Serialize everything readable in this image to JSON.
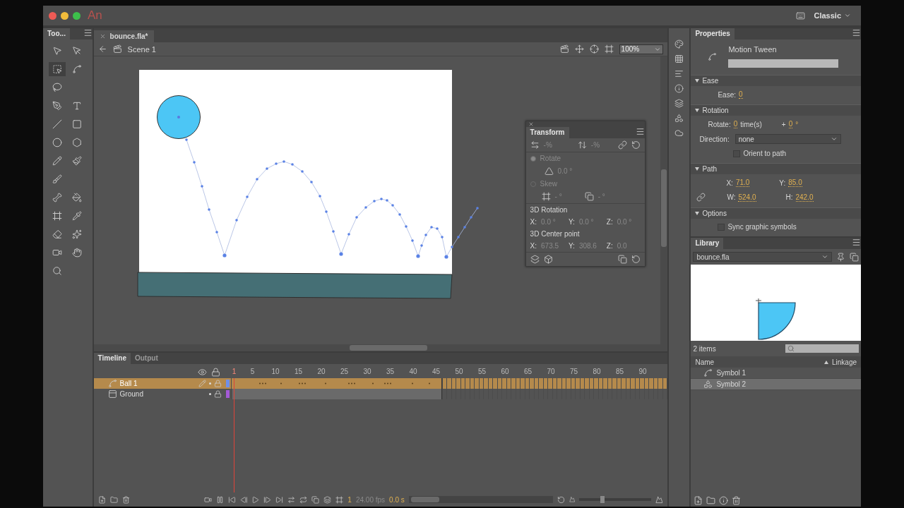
{
  "app": {
    "logo": "An",
    "workspace": "Classic"
  },
  "tools": {
    "title": "Too..."
  },
  "document": {
    "tab": "bounce.fla*",
    "scene": "Scene 1",
    "zoom": "100%"
  },
  "transform": {
    "title": "Transform",
    "disabled": true,
    "width": "-%",
    "height": "-%",
    "modes": [
      {
        "label": "Rotate",
        "selected": true
      },
      {
        "label": "Skew",
        "selected": false
      }
    ],
    "rotate_value": "0.0 °",
    "skew_h": "- °",
    "skew_v": "- °",
    "rotation_3d": {
      "label": "3D Rotation",
      "axes": [
        {
          "axis": "X:",
          "value": "0.0 °"
        },
        {
          "axis": "Y:",
          "value": "0.0 °"
        },
        {
          "axis": "Z:",
          "value": "0.0 °"
        }
      ]
    },
    "center_3d": {
      "label": "3D Center point",
      "axes": [
        {
          "axis": "X:",
          "value": "673.5"
        },
        {
          "axis": "Y:",
          "value": "308.6"
        },
        {
          "axis": "Z:",
          "value": "0.0"
        }
      ]
    }
  },
  "properties": {
    "title": "Properties",
    "type": "Motion Tween",
    "sections": [
      {
        "kind": "ease",
        "title": "Ease",
        "expanded": true,
        "label": "Ease:",
        "value": "0"
      },
      {
        "kind": "rotation",
        "title": "Rotation",
        "expanded": true,
        "rotate_label": "Rotate:",
        "count": "0",
        "unit": "time(s)",
        "plus": "+",
        "degrees": "0",
        "degree_sign": "°",
        "direction_label": "Direction:",
        "direction": "none",
        "orient": {
          "label": "Orient to path",
          "checked": false
        }
      },
      {
        "kind": "path",
        "title": "Path",
        "expanded": true,
        "fields": [
          {
            "label": "X:",
            "value": "71.0"
          },
          {
            "label": "Y:",
            "value": "85.0"
          },
          {
            "label": "W:",
            "value": "524.0"
          },
          {
            "label": "H:",
            "value": "242.0"
          }
        ]
      },
      {
        "kind": "options",
        "title": "Options",
        "expanded": true,
        "sync": {
          "label": "Sync graphic symbols",
          "checked": false
        }
      }
    ]
  },
  "library": {
    "title": "Library",
    "file": "bounce.fla",
    "count": "2 items",
    "columns": [
      "Name",
      "Linkage"
    ],
    "items": [
      {
        "name": "Symbol 1",
        "kind": "tween",
        "selected": false
      },
      {
        "name": "Symbol 2",
        "kind": "graphic",
        "selected": true
      }
    ]
  },
  "timeline": {
    "tabs": [
      {
        "label": "Timeline",
        "selected": true
      },
      {
        "label": "Output",
        "selected": false
      }
    ],
    "ticks": [
      "1",
      "5",
      "10",
      "15",
      "20",
      "25",
      "30",
      "35",
      "40",
      "45",
      "50",
      "55",
      "60",
      "65",
      "70",
      "75",
      "80",
      "85",
      "90"
    ],
    "layers": [
      {
        "name": "Ball 1",
        "kind": "tween",
        "selected": true,
        "color": "#6f8fe8"
      },
      {
        "name": "Ground",
        "kind": "static",
        "selected": false,
        "color": "#a45ad6"
      }
    ],
    "frame": "1",
    "fps": "24.00 fps",
    "time": "0.0 s",
    "zoom_slider": {
      "level": 0.3
    }
  }
}
